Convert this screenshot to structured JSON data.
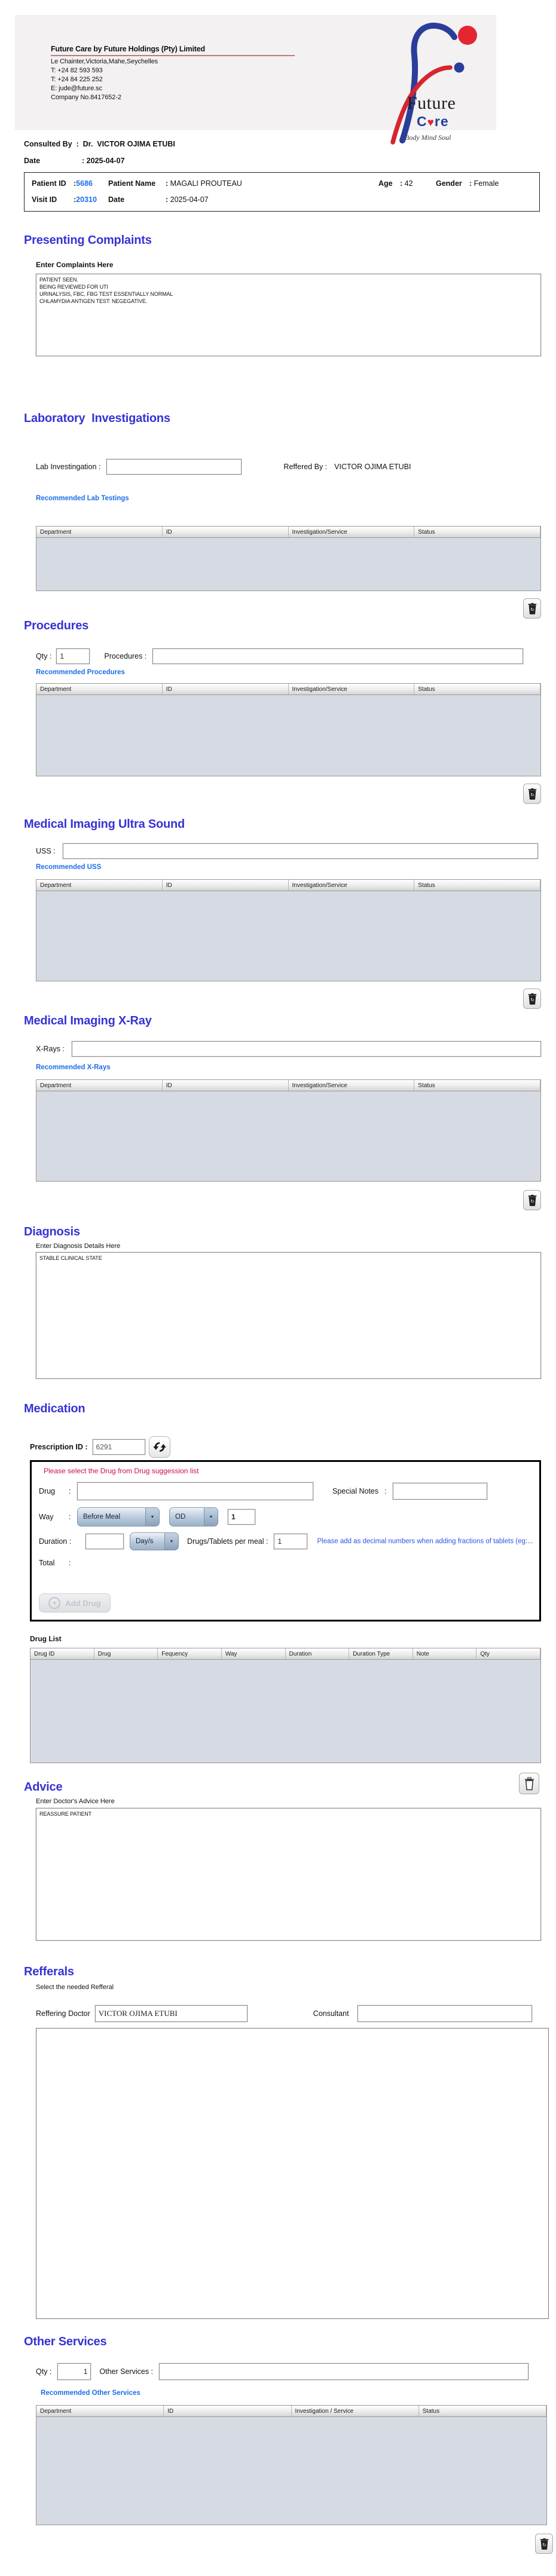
{
  "letterhead": {
    "company": "Future Care by Future Holdings (Pty) Limited",
    "lines": [
      "Le Chainter,Victoria,Mahe,Seychelles",
      "T: +24  82 593 593",
      "T: +24  84 225 252",
      "E: jude@future.sc",
      "Company No.8417652-2"
    ],
    "logo_word1": "Future",
    "logo_c": "C",
    "logo_heart": "♥",
    "logo_re": "re",
    "logo_tagline": "Body Mind Soul"
  },
  "consult": {
    "label": "Consulted By  :  Dr.  ",
    "doctor": "VICTOR OJIMA ETUBI",
    "date_label": "Date",
    "date_value": ": 2025-04-07"
  },
  "patient": {
    "id_label": "Patient ID",
    "id_sep": ":",
    "id": "5686",
    "name_label": "Patient Name",
    "name_sep": ":",
    "name": "MAGALI PROUTEAU",
    "age_label": "Age",
    "age_sep": ":",
    "age": "42",
    "gender_label": "Gender",
    "gender_sep": ":",
    "gender": "Female",
    "visit_label": "Visit ID",
    "visit_sep": ":",
    "visit": "20310",
    "date_label": "Date",
    "date_sep": ":",
    "date": "2025-04-07"
  },
  "headers": {
    "generic": [
      "Department",
      "ID",
      "Investigation/Service",
      "Status"
    ],
    "other": [
      "Department",
      "ID",
      "Investigation / Service",
      "Status"
    ],
    "drug": [
      "Drug ID",
      "Drug",
      "Fequency",
      "Way",
      "Duration",
      "Duration Type",
      "Note",
      "Qty"
    ]
  },
  "sections": {
    "complaints": {
      "title": "Presenting Complaints",
      "label": "Enter Complaints Here",
      "text": "PATIENT SEEN.\nBEING REVIEWED FOR UTI\nURINALYSIS, FBC, FBG TEST ESSENTIALLY NORMAL\nCHLAMYDIA ANTIGEN TEST: NEGEGATIVE."
    },
    "lab": {
      "title": "Laboratory  Investigations",
      "input_label": "Lab Investingation :",
      "input_value": "",
      "referred_label": "Reffered By :",
      "referred_value": "VICTOR OJIMA ETUBI",
      "recommended": "Recommended Lab Testings"
    },
    "procedures": {
      "title": "Procedures",
      "qty_label": "Qty :",
      "qty": "1",
      "input_label": "Procedures :",
      "input_value": "",
      "recommended": "Recommended Procedures"
    },
    "uss": {
      "title": "Medical Imaging Ultra Sound",
      "input_label": "USS :",
      "input_value": "",
      "recommended": "Recommended USS"
    },
    "xray": {
      "title": "Medical Imaging X-Ray",
      "input_label": "X-Rays :",
      "input_value": "",
      "recommended": "Recommended X-Rays"
    },
    "diagnosis": {
      "title": "Diagnosis",
      "label": "Enter Diagnosis Details Here",
      "text": "STABLE CLINICAL STATE"
    },
    "medication": {
      "title": "Medication",
      "rx_label": "Prescription ID :",
      "rx_value": "6291",
      "warning": "Please select the Drug from Drug suggession list",
      "drug_label": "Drug",
      "colon": ":",
      "drug_value": "",
      "special_label": "Special Notes",
      "special_value": "",
      "way_label": "Way",
      "way_value": "Before Meal",
      "freq_value": "OD",
      "way_qty": "1",
      "duration_label": "Duration :",
      "duration_value": "",
      "duration_unit": "Day/s",
      "per_meal_label": "Drugs/Tablets per meal :",
      "per_meal_value": "1",
      "note": "Please add as decimal numbers when adding fractions of tablets (eg:...",
      "total_label": "Total",
      "add_drug_label": "Add Drug"
    },
    "drug_list": {
      "label": "Drug List"
    },
    "advice": {
      "title": "Advice",
      "label": "Enter Doctor's Advice Here",
      "text": "REASSURE PATIENT"
    },
    "refferals": {
      "title": "Refferals",
      "sub": "Select the needed Refferal",
      "doctor_label": "Reffering Doctor",
      "doctor_value": "VICTOR OJIMA ETUBI",
      "consultant_label": "Consultant",
      "consultant_value": ""
    },
    "other": {
      "title": "Other Services",
      "qty_label": "Qty :",
      "qty": "1",
      "input_label": "Other Services :",
      "input_value": "",
      "recommended": "Recommended Other Services"
    }
  },
  "colors": {
    "heading_blue": "#3732d4",
    "link_blue": "#1d6ee8",
    "warning_red": "#cf0a4e",
    "table_body": "#d6dae2"
  }
}
